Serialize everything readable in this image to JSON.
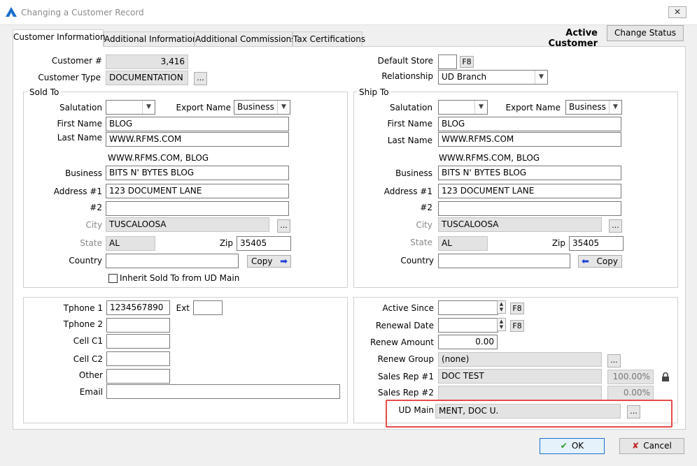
{
  "window": {
    "title": "Changing a Customer Record",
    "close": "✕"
  },
  "tabs": [
    "Customer Information",
    "Additional Information",
    "Additional Commissions",
    "Tax Certifications"
  ],
  "header": {
    "status_text": "Active Customer",
    "change_status": "Change Status"
  },
  "customer": {
    "num_label": "Customer #",
    "num_value": "3,416",
    "type_label": "Customer Type",
    "type_value": "DOCUMENTATION",
    "browse": "..."
  },
  "store": {
    "label": "Default Store",
    "value": "",
    "f8": "F8",
    "rel_label": "Relationship",
    "rel_value": "UD Branch"
  },
  "sold_to": {
    "title": "Sold To",
    "salutation_label": "Salutation",
    "salutation_value": "",
    "export_label": "Export Name",
    "export_value": "Business",
    "first_label": "First Name",
    "first_value": "BLOG",
    "last_label": "Last Name",
    "last_value": "WWW.RFMS.COM",
    "display_name": "WWW.RFMS.COM, BLOG",
    "business_label": "Business",
    "business_value": "BITS N' BYTES BLOG",
    "addr1_label": "Address #1",
    "addr1_value": "123 DOCUMENT LANE",
    "addr2_label": "#2",
    "addr2_value": "",
    "city_label": "City",
    "city_value": "TUSCALOOSA",
    "browse": "...",
    "state_label": "State",
    "state_value": "AL",
    "zip_label": "Zip",
    "zip_value": "35405",
    "country_label": "Country",
    "country_value": "",
    "copy": "Copy",
    "inherit_label": "Inherit Sold To from UD Main"
  },
  "ship_to": {
    "title": "Ship To",
    "salutation_label": "Salutation",
    "salutation_value": "",
    "export_label": "Export Name",
    "export_value": "Business",
    "first_label": "First Name",
    "first_value": "BLOG",
    "last_label": "Last Name",
    "last_value": "WWW.RFMS.COM",
    "display_name": "WWW.RFMS.COM, BLOG",
    "business_label": "Business",
    "business_value": "BITS N' BYTES BLOG",
    "addr1_label": "Address #1",
    "addr1_value": "123 DOCUMENT LANE",
    "addr2_label": "#2",
    "addr2_value": "",
    "city_label": "City",
    "city_value": "TUSCALOOSA",
    "browse": "...",
    "state_label": "State",
    "state_value": "AL",
    "zip_label": "Zip",
    "zip_value": "35405",
    "country_label": "Country",
    "country_value": "",
    "copy": "Copy"
  },
  "contact": {
    "phone1_label": "Tphone 1",
    "phone1_value": "1234567890",
    "ext_label": "Ext",
    "ext_value": "",
    "phone2_label": "Tphone 2",
    "cell1_label": "Cell C1",
    "cell2_label": "Cell C2",
    "other_label": "Other",
    "email_label": "Email"
  },
  "account": {
    "active_label": "Active Since",
    "renewal_label": "Renewal Date",
    "f8": "F8",
    "renew_amount_label": "Renew Amount",
    "renew_amount_value": "0.00",
    "renew_group_label": "Renew Group",
    "renew_group_value": "(none)",
    "rep1_label": "Sales Rep #1",
    "rep1_value": "DOC TEST",
    "rep1_pct": "100.00%",
    "rep2_label": "Sales Rep #2",
    "rep2_value": "",
    "rep2_pct": "0.00%",
    "ud_label": "UD Main",
    "ud_value": "MENT, DOC U.",
    "browse": "..."
  },
  "footer": {
    "ok": "OK",
    "cancel": "Cancel"
  },
  "colors": {
    "highlight": "#e84a4a",
    "accent": "#1a6fd0",
    "ok_check": "#2c9a2c",
    "cancel_x": "#c02020"
  }
}
